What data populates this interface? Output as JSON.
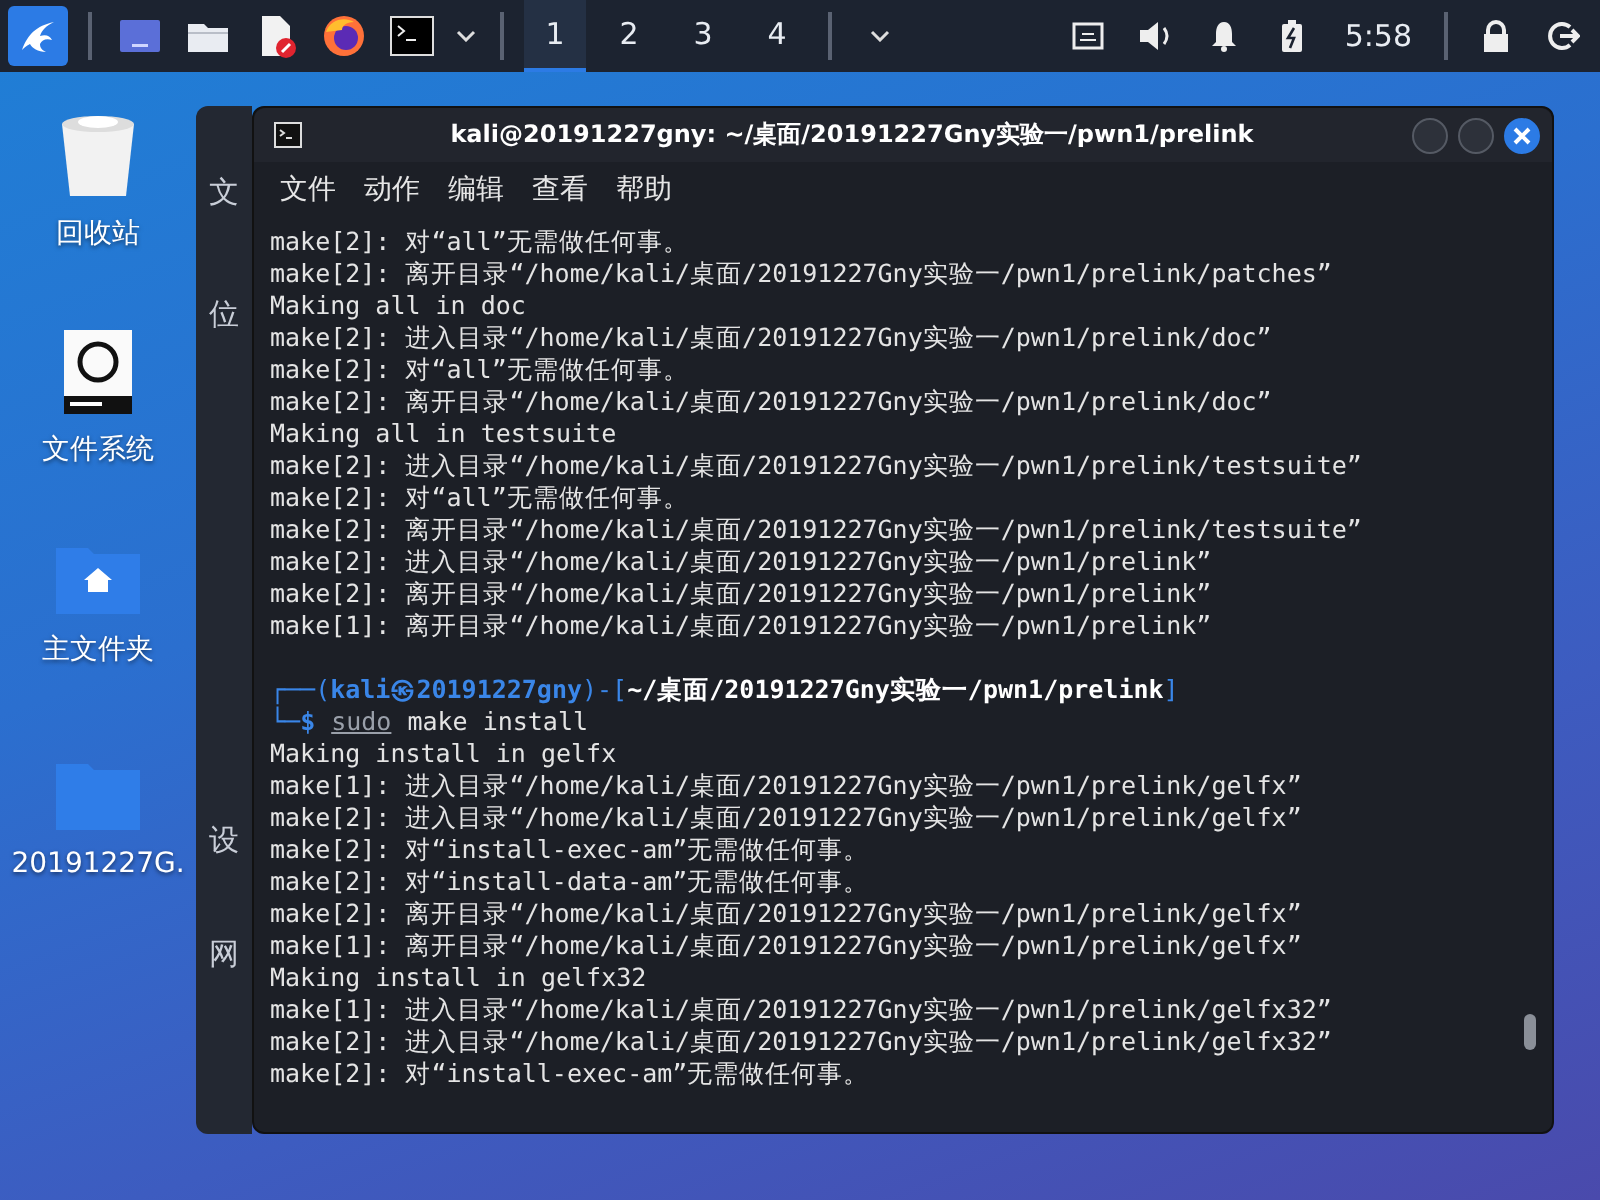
{
  "taskbar": {
    "apps": [
      {
        "kind": "desktop"
      },
      {
        "kind": "files"
      },
      {
        "kind": "editor"
      },
      {
        "kind": "browser"
      },
      {
        "kind": "terminal"
      }
    ],
    "workspaces": [
      {
        "label": "1",
        "selected": true
      },
      {
        "label": "2",
        "selected": false
      },
      {
        "label": "3",
        "selected": false
      },
      {
        "label": "4",
        "selected": false
      }
    ],
    "clock": "5:58"
  },
  "desktop_icons": [
    {
      "kind": "trash",
      "label": "回收站"
    },
    {
      "kind": "drive",
      "label": "文件系统"
    },
    {
      "kind": "home",
      "label": "主文件夹"
    },
    {
      "kind": "folder",
      "label": "20191227G."
    }
  ],
  "file_manager": {
    "sidebar": [
      "文",
      "位",
      "设",
      "网"
    ]
  },
  "terminal": {
    "title": "kali@20191227gny: ~/桌面/20191227Gny实验一/pwn1/prelink",
    "menu": [
      "文件",
      "动作",
      "编辑",
      "查看",
      "帮助"
    ],
    "lines": [
      {
        "kind": "text",
        "text": "make[2]: 对“all”无需做任何事。"
      },
      {
        "kind": "text",
        "text": "make[2]: 离开目录“/home/kali/桌面/20191227Gny实验一/pwn1/prelink/patches”"
      },
      {
        "kind": "text",
        "text": "Making all in doc"
      },
      {
        "kind": "text",
        "text": "make[2]: 进入目录“/home/kali/桌面/20191227Gny实验一/pwn1/prelink/doc”"
      },
      {
        "kind": "text",
        "text": "make[2]: 对“all”无需做任何事。"
      },
      {
        "kind": "text",
        "text": "make[2]: 离开目录“/home/kali/桌面/20191227Gny实验一/pwn1/prelink/doc”"
      },
      {
        "kind": "text",
        "text": "Making all in testsuite"
      },
      {
        "kind": "text",
        "text": "make[2]: 进入目录“/home/kali/桌面/20191227Gny实验一/pwn1/prelink/testsuite”"
      },
      {
        "kind": "text",
        "text": "make[2]: 对“all”无需做任何事。"
      },
      {
        "kind": "text",
        "text": "make[2]: 离开目录“/home/kali/桌面/20191227Gny实验一/pwn1/prelink/testsuite”"
      },
      {
        "kind": "text",
        "text": "make[2]: 进入目录“/home/kali/桌面/20191227Gny实验一/pwn1/prelink”"
      },
      {
        "kind": "text",
        "text": "make[2]: 离开目录“/home/kali/桌面/20191227Gny实验一/pwn1/prelink”"
      },
      {
        "kind": "text",
        "text": "make[1]: 离开目录“/home/kali/桌面/20191227Gny实验一/pwn1/prelink”"
      },
      {
        "kind": "blank"
      },
      {
        "kind": "prompt_head",
        "frame_open": "┌──(",
        "user_host": "kali㉿20191227gny",
        "frame_mid": ")-[",
        "path": "~/桌面/20191227Gny实验一/pwn1/prelink",
        "frame_close": "]"
      },
      {
        "kind": "prompt_input",
        "frame": "└─",
        "dollar": "$",
        "sudo": "sudo",
        "command": "make install"
      },
      {
        "kind": "text",
        "text": "Making install in gelfx"
      },
      {
        "kind": "text",
        "text": "make[1]: 进入目录“/home/kali/桌面/20191227Gny实验一/pwn1/prelink/gelfx”"
      },
      {
        "kind": "text",
        "text": "make[2]: 进入目录“/home/kali/桌面/20191227Gny实验一/pwn1/prelink/gelfx”"
      },
      {
        "kind": "text",
        "text": "make[2]: 对“install-exec-am”无需做任何事。"
      },
      {
        "kind": "text",
        "text": "make[2]: 对“install-data-am”无需做任何事。"
      },
      {
        "kind": "text",
        "text": "make[2]: 离开目录“/home/kali/桌面/20191227Gny实验一/pwn1/prelink/gelfx”"
      },
      {
        "kind": "text",
        "text": "make[1]: 离开目录“/home/kali/桌面/20191227Gny实验一/pwn1/prelink/gelfx”"
      },
      {
        "kind": "text",
        "text": "Making install in gelfx32"
      },
      {
        "kind": "text",
        "text": "make[1]: 进入目录“/home/kali/桌面/20191227Gny实验一/pwn1/prelink/gelfx32”"
      },
      {
        "kind": "text",
        "text": "make[2]: 进入目录“/home/kali/桌面/20191227Gny实验一/pwn1/prelink/gelfx32”"
      },
      {
        "kind": "text",
        "text": "make[2]: 对“install-exec-am”无需做任何事。"
      }
    ]
  }
}
